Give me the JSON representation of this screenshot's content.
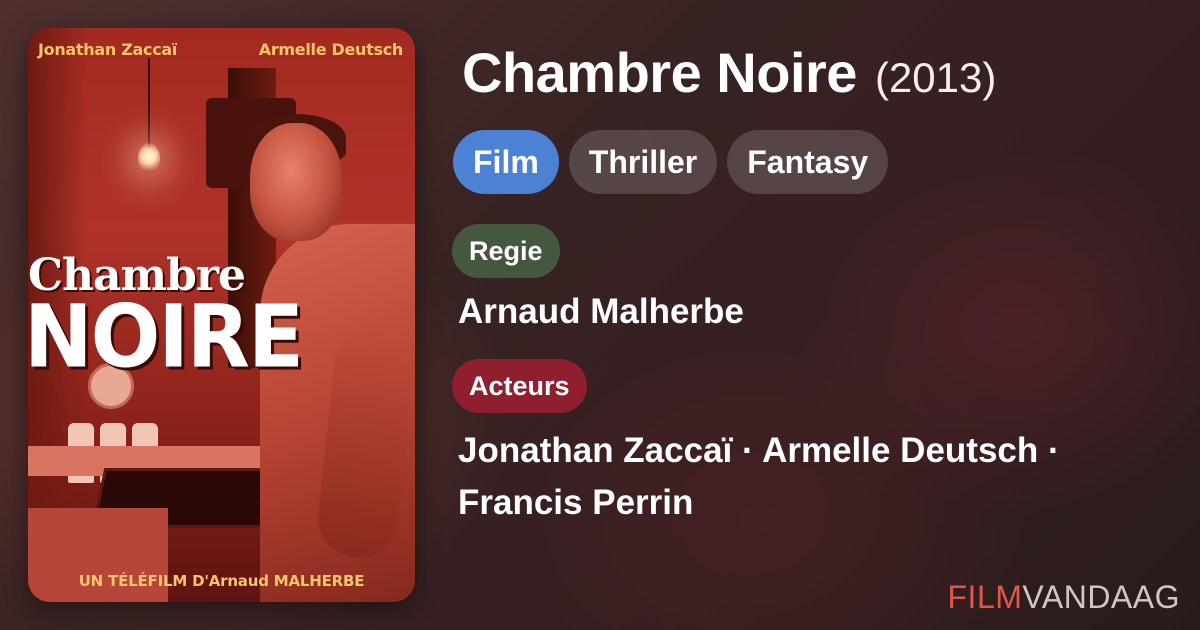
{
  "poster": {
    "credit_left": "Jonathan Zaccaï",
    "credit_right": "Armelle Deutsch",
    "title_line1": "Chambre",
    "title_line2": "NOIRE",
    "tagline": "UN TÉLÉFILM D'Arnaud MALHERBE"
  },
  "movie": {
    "title": "Chambre Noire",
    "year": "(2013)"
  },
  "genres": [
    "Film",
    "Thriller",
    "Fantasy"
  ],
  "regie": {
    "label": "Regie",
    "name": "Arnaud Malherbe"
  },
  "acteurs": {
    "label": "Acteurs",
    "line1": "Jonathan Zaccaï · Armelle Deutsch ·",
    "line2": "Francis Perrin"
  },
  "brand": {
    "part1": "FILM",
    "part2": "VANDAAG"
  },
  "colors": {
    "primary_chip": "#4b82d4",
    "regie_chip": "#46573f",
    "acteurs_chip": "#8f1f2f",
    "brand_accent": "#e0574a"
  }
}
